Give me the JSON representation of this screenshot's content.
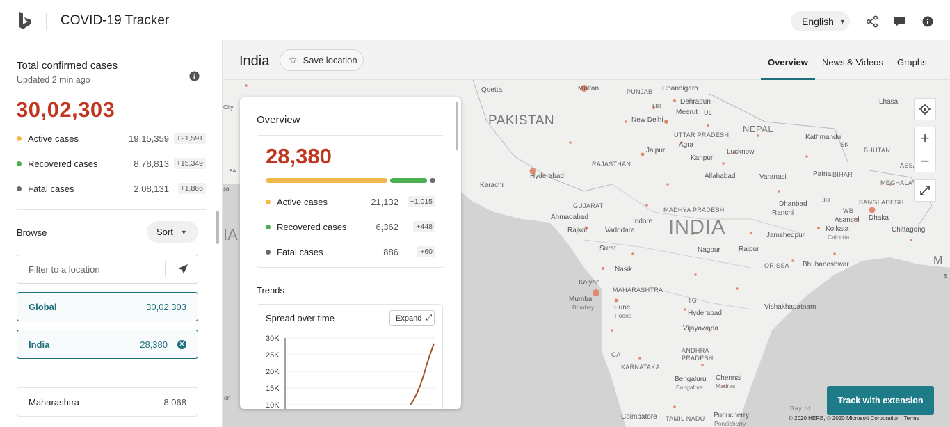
{
  "header": {
    "app_title": "COVID-19 Tracker",
    "language": "English",
    "icons": [
      "bing-logo-icon",
      "share-icon",
      "feedback-icon",
      "info-icon"
    ]
  },
  "left_panel": {
    "title": "Total confirmed cases",
    "updated": "Updated 2 min ago",
    "total": "30,02,303",
    "stats": [
      {
        "label": "Active cases",
        "value": "19,15,359",
        "delta": "+21,591",
        "color": "#f0b94a"
      },
      {
        "label": "Recovered cases",
        "value": "8,78,813",
        "delta": "+15,349",
        "color": "#4caf50"
      },
      {
        "label": "Fatal cases",
        "value": "2,08,131",
        "delta": "+1,866",
        "color": "#6b6b6b"
      }
    ],
    "browse_label": "Browse",
    "sort_label": "Sort",
    "filter_placeholder": "Filter to a location",
    "locations": [
      {
        "name": "Global",
        "value": "30,02,303"
      },
      {
        "name": "India",
        "value": "28,380"
      }
    ],
    "states": [
      {
        "name": "Maharashtra",
        "value": "8,068"
      }
    ]
  },
  "region_bar": {
    "region": "India",
    "save_label": "Save location",
    "tabs": [
      "Overview",
      "News & Videos",
      "Graphs"
    ],
    "active_tab": "Overview"
  },
  "overview": {
    "title": "Overview",
    "total": "28,380",
    "stats": [
      {
        "label": "Active cases",
        "value": "21,132",
        "delta": "+1,015",
        "color": "#f0b94a"
      },
      {
        "label": "Recovered cases",
        "value": "6,362",
        "delta": "+448",
        "color": "#4caf50"
      },
      {
        "label": "Fatal cases",
        "value": "886",
        "delta": "+60",
        "color": "#6b6b6b"
      }
    ],
    "trends_label": "Trends",
    "trend_title": "Spread over time",
    "expand_label": "Expand"
  },
  "chart_data": {
    "type": "line",
    "title": "Spread over time",
    "y_ticks": [
      "30K",
      "25K",
      "20K",
      "15K",
      "10K"
    ],
    "ylim": [
      10000,
      30000
    ],
    "series": [
      {
        "values": [
          10000,
          11500,
          13500,
          16000,
          19000,
          22500,
          25500,
          28380
        ]
      }
    ]
  },
  "map": {
    "labels": {
      "quetta": "Quetta",
      "multan": "Multan",
      "punjab": "PUNJAB",
      "chandigarh": "Chandigarh",
      "dehradun": "Dehradun",
      "meerut": "Meerut",
      "ul": "UL",
      "hr": "HR",
      "lhasa": "Lhasa",
      "pakistan": "PAKISTAN",
      "newdelhi": "New Delhi",
      "nepal": "NEPAL",
      "uttarpradesh": "UTTAR PRADESH",
      "agra": "Agra",
      "kathmandu": "Kathmandu",
      "sk": "SK",
      "bhutan": "BHUTAN",
      "jaipur": "Jaipur",
      "lucknow": "Lucknow",
      "rajasthan": "RAJASTHAN",
      "kanpur": "Kanpur",
      "assam": "ASSAM",
      "hyderabad_pk": "Hyderabad",
      "allahabad": "Allahabad",
      "varanasi": "Varanasi",
      "patna": "Patna",
      "bihar": "BIHAR",
      "meghalaya": "MEGHALAYA",
      "karachi": "Karachi",
      "madhyapradesh": "MADHYA PRADESH",
      "gujarat": "GUJARAT",
      "dhanbad": "Dhanbad",
      "jh": "JH",
      "wb": "WB",
      "bangladesh": "BANGLADESH",
      "ahmadabad": "Ahmadabad",
      "india": "INDIA",
      "ranchi": "Ranchi",
      "asansol": "Asansol",
      "dhaka": "Dhaka",
      "indore": "Indore",
      "rajkot": "Rajkot",
      "vadodara": "Vadodara",
      "kolkata": "Kolkata",
      "calcutta": "Calcutta",
      "chittagong": "Chittagong",
      "jamshedpur": "Jamshedpur",
      "nagpur": "Nagpur",
      "raipur": "Raipur",
      "surat": "Surat",
      "orissa": "ORISSA",
      "bhubaneshwar": "Bhubaneshwar",
      "m": "M",
      "nasik": "Nasik",
      "kalyan": "Kalyan",
      "maharashtra": "MAHARASHTRA",
      "mumbai": "Mumbai",
      "bombay": "Bombay",
      "tg": "TG",
      "pune": "Pune",
      "poona": "Poona",
      "vishakhapatnam": "Vishakhapatnam",
      "hyderabad": "Hyderabad",
      "vijayawada": "Vijayawada",
      "andhrapradesh": "ANDHRA PRADESH",
      "ga": "GA",
      "karnataka": "KARNATAKA",
      "chennai": "Chennai",
      "madras": "Madras",
      "bengaluru": "Bengaluru",
      "bangalore": "Bangalore",
      "bayof": "Bay of",
      "coimbatore": "Coimbatore",
      "tamilnadu": "TAMIL NADU",
      "puducherry": "Puducherry",
      "pondicherry": "Pondicherry",
      "city": "City",
      "ia": "IA",
      "en": "en",
      "ba": "BA",
      "sa": "sa",
      "s": "S"
    },
    "track_label": "Track with extension",
    "copyright": "© 2020 HERE, © 2020 Microsoft Corporation",
    "terms": "Terms"
  }
}
